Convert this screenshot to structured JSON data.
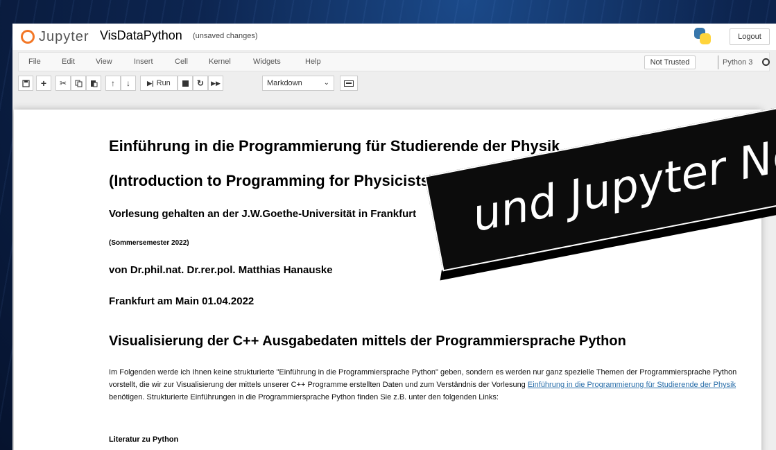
{
  "header": {
    "logo_text": "Jupyter",
    "notebook_title": "VisDataPython",
    "save_status": "(unsaved changes)",
    "logout_label": "Logout"
  },
  "menubar": {
    "items": [
      "File",
      "Edit",
      "View",
      "Insert",
      "Cell",
      "Kernel",
      "Widgets",
      "Help"
    ],
    "trust_label": "Not Trusted",
    "kernel_name": "Python 3"
  },
  "toolbar": {
    "run_label": "Run",
    "cell_type": "Markdown"
  },
  "notebook": {
    "title_de": "Einführung in die Programmierung für Studierende der Physik",
    "title_en": "(Introduction to Programming for Physicists)",
    "lecture": "Vorlesung gehalten an der J.W.Goethe-Universität in Frankfurt",
    "semester": "(Sommersemester 2022)",
    "author": "von Dr.phil.nat. Dr.rer.pol. Matthias Hanauske",
    "place_date": "Frankfurt am Main 01.04.2022",
    "section_title": "Visualisierung der C++ Ausgabedaten mittels der Programmiersprache Python",
    "para_before_link": "Im Folgenden werde ich Ihnen keine strukturierte \"Einführung in die Programmiersprache Python\" geben, sondern es werden nur ganz spezielle Themen der Programmiersprache Python vorstellt, die wir zur Visualisierung der mittels unserer C++ Programme erstellten Daten und zum Verständnis der Vorlesung ",
    "para_link": "Einführung in die Programmierung für Studierende der Physik",
    "para_after_link": " benötigen. Strukturierte Einführungen in die Programmiersprache Python finden Sie z.B. unter den folgenden Links:",
    "literature_heading": "Literatur zu Python"
  },
  "overlay": {
    "banner_text": "und Jupyter Not"
  },
  "colors": {
    "jupyter_orange": "#f37726",
    "link_blue": "#296eaa",
    "python_blue": "#3776ab",
    "python_yellow": "#ffd43b"
  }
}
